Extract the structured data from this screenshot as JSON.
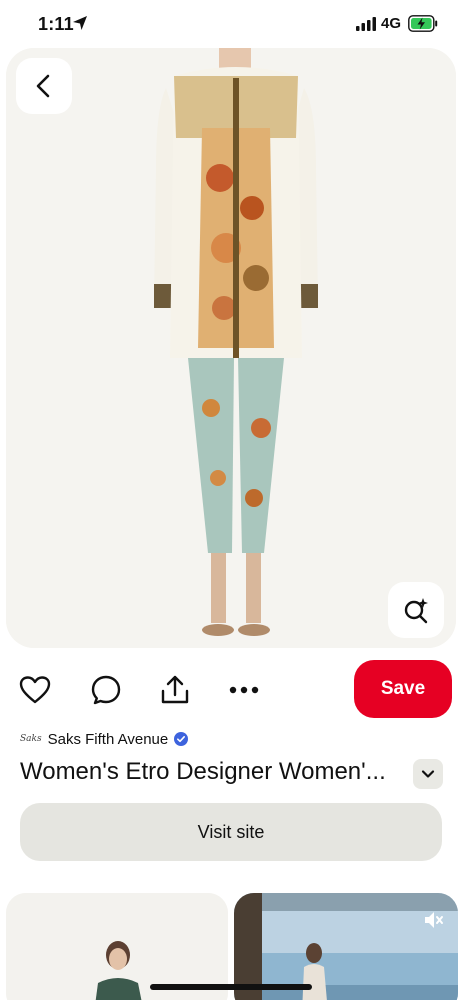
{
  "status_bar": {
    "time": "1:11",
    "network": "4G",
    "icons": [
      "location-arrow-icon",
      "signal-bars-icon",
      "battery-charging-icon"
    ]
  },
  "pin": {
    "image_alt": "",
    "back_icon": "chevron-left-icon",
    "lens_icon": "visual-search-icon"
  },
  "actions": {
    "icons": [
      "heart-icon",
      "comment-icon",
      "share-icon",
      "more-icon"
    ],
    "save_label": "Save",
    "save_color": "#e60023"
  },
  "source": {
    "logo_text": "Saks",
    "name": "Saks Fifth Avenue",
    "verified_color": "#3d63dd"
  },
  "title": "Women's Etro Designer Women'...",
  "visit_label": "Visit site",
  "related": {
    "right_icon": "muted-speaker-icon"
  }
}
